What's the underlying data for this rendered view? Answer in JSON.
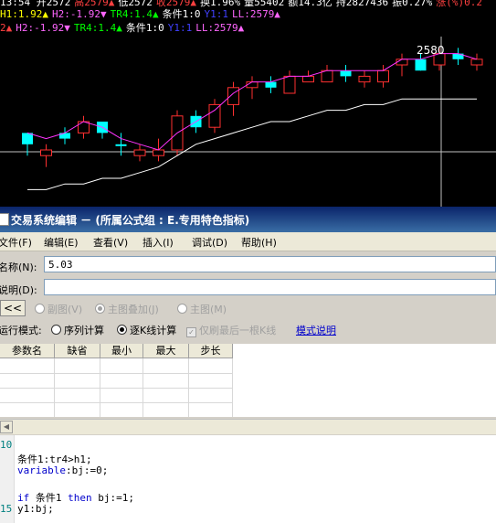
{
  "chart": {
    "info_line1": [
      {
        "text": "13:54 开2572",
        "color": "#ffffff"
      },
      {
        "text": "高2579▲",
        "color": "#ff4040"
      },
      {
        "text": "低2572",
        "color": "#ffffff"
      },
      {
        "text": "收2579▲",
        "color": "#ff4040"
      },
      {
        "text": "换1.96%",
        "color": "#ffffff"
      },
      {
        "text": "量55402",
        "color": "#ffffff"
      },
      {
        "text": "额14.3亿",
        "color": "#ffffff"
      },
      {
        "text": "持2827436",
        "color": "#ffffff"
      },
      {
        "text": "振0.27%",
        "color": "#ffffff"
      },
      {
        "text": "涨(%)0.2",
        "color": "#ff4040"
      }
    ],
    "info_line2": [
      {
        "text": "2▲",
        "color": "#ff4040"
      },
      {
        "text": "H2:-1.92▼",
        "color": "#ff66ff"
      },
      {
        "text": "TR4:1.4▲",
        "color": "#00ff00"
      },
      {
        "text": "条件1:0",
        "color": "#ffffff"
      },
      {
        "text": "Y1:1",
        "color": "#4040ff"
      },
      {
        "text": "LL:2579▲",
        "color": "#ff66ff"
      }
    ],
    "info_line1_overlay": [
      {
        "text": "H1:1.92▲",
        "color": "#ffff00"
      },
      {
        "text": "H2:-1.92▼",
        "color": "#ff66ff"
      },
      {
        "text": "TR4:1.4▲",
        "color": "#00ff00"
      },
      {
        "text": "条件1:0",
        "color": "#ffffff"
      },
      {
        "text": "Y1:1",
        "color": "#4040ff"
      },
      {
        "text": "LL:2579▲",
        "color": "#ff66ff"
      }
    ],
    "price_label": "2580",
    "candles": [
      {
        "o": 2566,
        "h": 2566,
        "l": 2562,
        "c": 2564,
        "col": "cyan"
      },
      {
        "o": 2562,
        "h": 2564,
        "l": 2560,
        "c": 2563,
        "col": "red"
      },
      {
        "o": 2565,
        "h": 2567,
        "l": 2564,
        "c": 2566,
        "col": "cyan"
      },
      {
        "o": 2566,
        "h": 2569,
        "l": 2565,
        "c": 2568,
        "col": "red"
      },
      {
        "o": 2568,
        "h": 2568,
        "l": 2565,
        "c": 2566,
        "col": "cyan"
      },
      {
        "o": 2564,
        "h": 2566,
        "l": 2562,
        "c": 2564,
        "col": "cyan"
      },
      {
        "o": 2562,
        "h": 2564,
        "l": 2561,
        "c": 2563,
        "col": "red"
      },
      {
        "o": 2563,
        "h": 2565,
        "l": 2561,
        "c": 2562,
        "col": "red"
      },
      {
        "o": 2563,
        "h": 2570,
        "l": 2562,
        "c": 2569,
        "col": "red"
      },
      {
        "o": 2569,
        "h": 2570,
        "l": 2566,
        "c": 2567,
        "col": "cyan"
      },
      {
        "o": 2567,
        "h": 2572,
        "l": 2566,
        "c": 2571,
        "col": "red"
      },
      {
        "o": 2571,
        "h": 2575,
        "l": 2569,
        "c": 2574,
        "col": "red"
      },
      {
        "o": 2574,
        "h": 2576,
        "l": 2572,
        "c": 2575,
        "col": "red"
      },
      {
        "o": 2575,
        "h": 2576,
        "l": 2573,
        "c": 2574,
        "col": "cyan"
      },
      {
        "o": 2573,
        "h": 2577,
        "l": 2573,
        "c": 2576,
        "col": "red"
      },
      {
        "o": 2576,
        "h": 2577,
        "l": 2575,
        "c": 2575,
        "col": "red"
      },
      {
        "o": 2575,
        "h": 2578,
        "l": 2575,
        "c": 2577,
        "col": "red"
      },
      {
        "o": 2577,
        "h": 2578,
        "l": 2575,
        "c": 2576,
        "col": "cyan"
      },
      {
        "o": 2576,
        "h": 2577,
        "l": 2574,
        "c": 2575,
        "col": "red"
      },
      {
        "o": 2575,
        "h": 2578,
        "l": 2574,
        "c": 2577,
        "col": "red"
      },
      {
        "o": 2578,
        "h": 2580,
        "l": 2576,
        "c": 2579,
        "col": "red"
      },
      {
        "o": 2579,
        "h": 2580,
        "l": 2577,
        "c": 2577,
        "col": "cyan"
      },
      {
        "o": 2578,
        "h": 2581,
        "l": 2577,
        "c": 2580,
        "col": "red"
      },
      {
        "o": 2580,
        "h": 2581,
        "l": 2578,
        "c": 2579,
        "col": "cyan"
      },
      {
        "o": 2579,
        "h": 2580,
        "l": 2577,
        "c": 2578,
        "col": "red"
      }
    ],
    "ma_upper": [
      2566,
      2565,
      2566,
      2568,
      2567,
      2565,
      2564,
      2563,
      2566,
      2568,
      2570,
      2573,
      2575,
      2575,
      2576,
      2576,
      2577,
      2577,
      2577,
      2577,
      2579,
      2579,
      2580,
      2580,
      2579
    ],
    "ma_lower": [
      2556,
      2556,
      2557,
      2557,
      2558,
      2558,
      2559,
      2560,
      2562,
      2564,
      2565,
      2566,
      2567,
      2568,
      2568,
      2569,
      2570,
      2570,
      2571,
      2571,
      2572,
      2572,
      2572,
      2572,
      2572
    ]
  },
  "editor": {
    "title": "交易系统编辑 － (所属公式组 : E.专用特色指标)",
    "menu": [
      "文件(F)",
      "编辑(E)",
      "查看(V)",
      "插入(I)",
      "调试(D)",
      "帮助(H)"
    ],
    "name_label": "名称(N):",
    "name_value": "5.03",
    "desc_label": "说明(D):",
    "desc_value": "",
    "collapse_label": "<<",
    "radios": [
      {
        "label": "副图(V)",
        "checked": false
      },
      {
        "label": "主图叠加(J)",
        "checked": true
      },
      {
        "label": "主图(M)",
        "checked": false
      }
    ],
    "mode_label": "运行模式:",
    "mode_radios": [
      {
        "label": "序列计算",
        "checked": false
      },
      {
        "label": "逐K线计算",
        "checked": true
      }
    ],
    "refresh_last_label": "仅刷最后一根K线",
    "mode_link": "模式说明",
    "param_headers": [
      "参数名",
      "缺省",
      "最小",
      "最大",
      "步长"
    ],
    "code_lines": [
      {
        "num": "10",
        "text": ""
      },
      {
        "num": "",
        "text": "条件1:tr4>h1;"
      },
      {
        "num": "",
        "text": "variable:bj:=0;"
      },
      {
        "num": "",
        "text": ""
      },
      {
        "num": "",
        "text": "if 条件1 then bj:=1;"
      },
      {
        "num": "15",
        "text": "y1:bj;"
      }
    ]
  }
}
